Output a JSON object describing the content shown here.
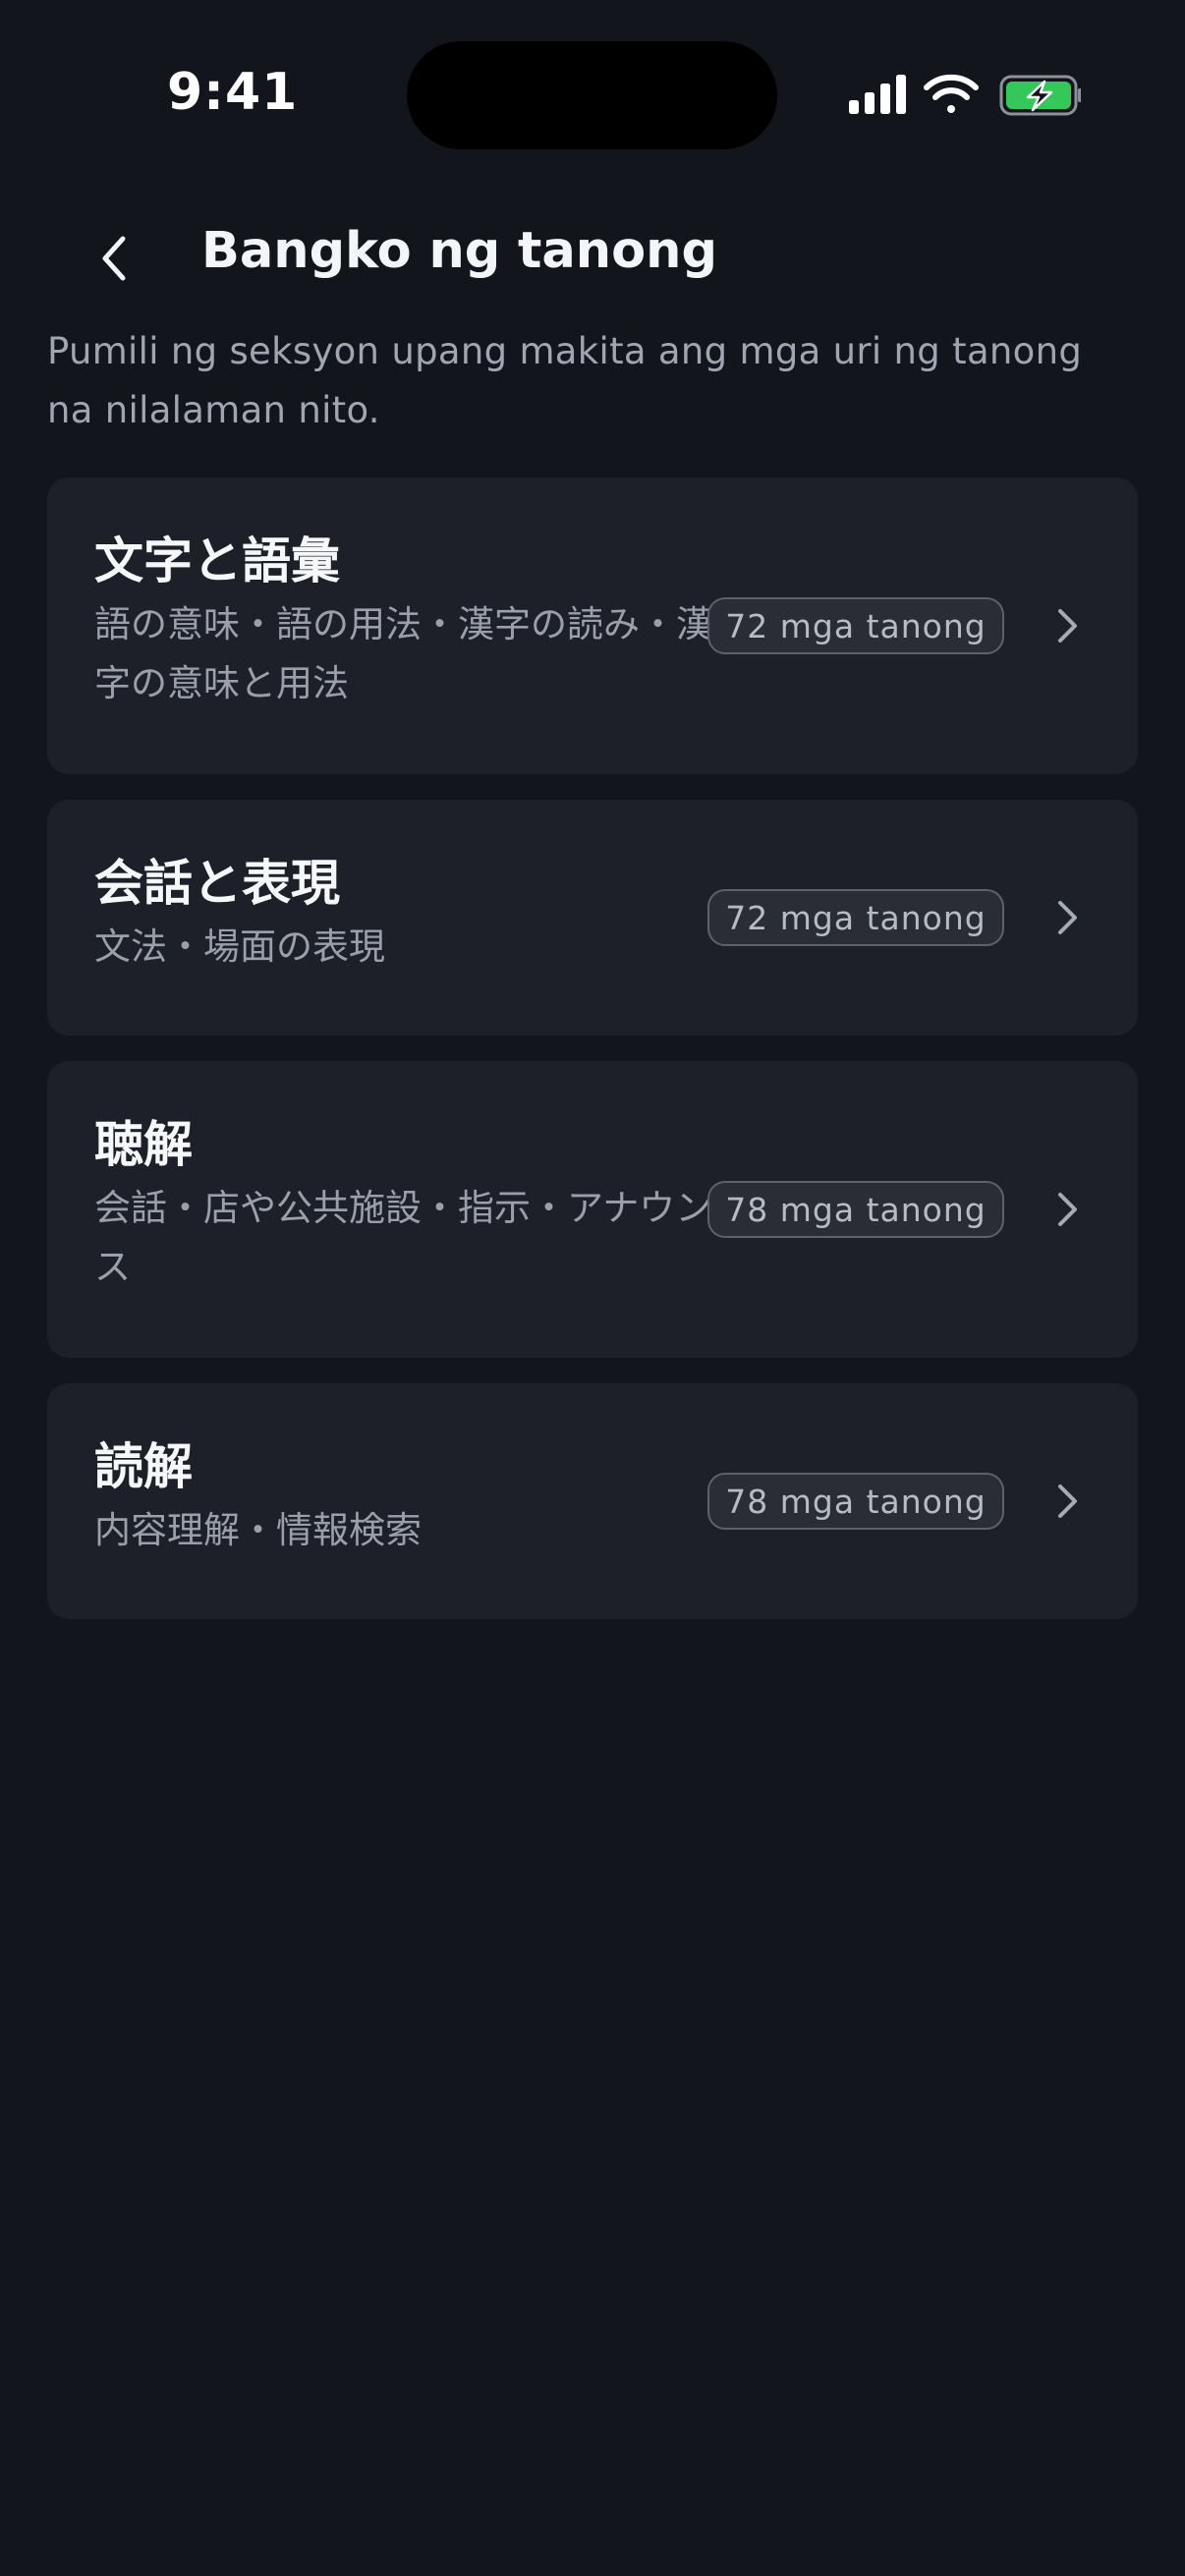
{
  "status_bar": {
    "time": "9:41"
  },
  "header": {
    "title": "Bangko ng tanong"
  },
  "description": "Pumili ng seksyon upang makita ang mga uri ng tanong na nilalaman nito.",
  "sections": [
    {
      "title": "文字と語彙",
      "subtitle": "語の意味・語の用法・漢字の読み・漢字の意味と用法",
      "count": "72 mga tanong"
    },
    {
      "title": "会話と表現",
      "subtitle": "文法・場面の表現",
      "count": "72 mga tanong"
    },
    {
      "title": "聴解",
      "subtitle": "会話・店や公共施設・指示・アナウンス",
      "count": "78 mga tanong"
    },
    {
      "title": "読解",
      "subtitle": "内容理解・情報検索",
      "count": "78 mga tanong"
    }
  ],
  "colors": {
    "background": "#13151d",
    "card": "#1e2029",
    "battery": "#34c759"
  },
  "icons": {
    "back": "chevron-left-icon",
    "row": "chevron-right-icon",
    "signal": "cellular-signal-icon",
    "wifi": "wifi-icon",
    "battery": "battery-charging-icon"
  }
}
